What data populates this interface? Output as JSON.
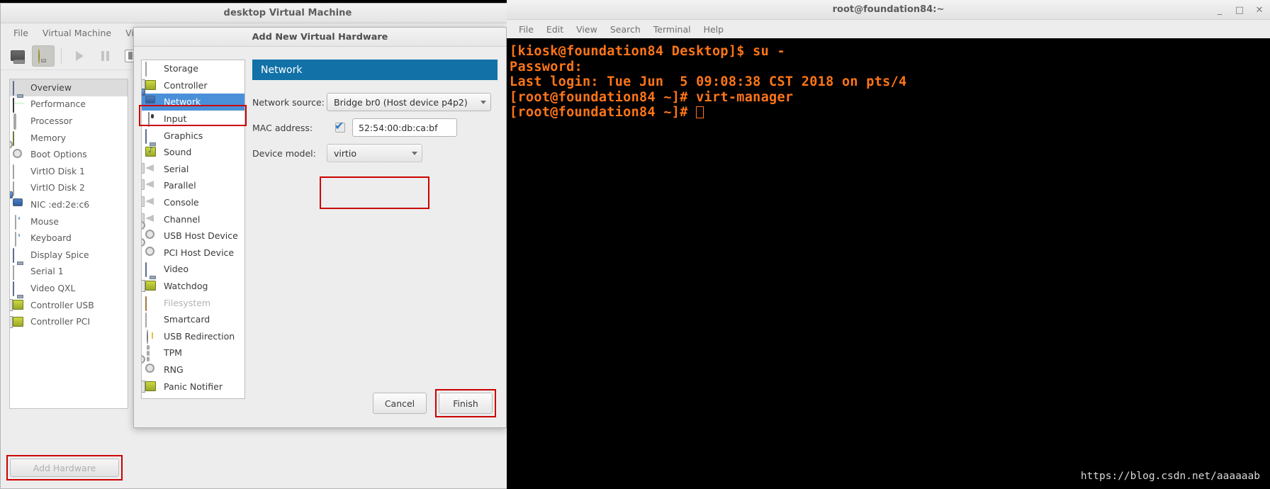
{
  "vm_window": {
    "title": "desktop Virtual Machine",
    "window_buttons": [
      {
        "name": "minimize",
        "glyph": "_"
      },
      {
        "name": "maximize",
        "glyph": "□"
      },
      {
        "name": "close",
        "glyph": "✕"
      }
    ],
    "menus": [
      "File",
      "Virtual Machine",
      "View"
    ],
    "toolbar": [
      {
        "name": "show-console-button",
        "icon": "monitor-icon"
      },
      {
        "name": "show-details-button",
        "icon": "lightbulb-icon"
      },
      {
        "name": "run-button",
        "icon": "play-icon"
      },
      {
        "name": "pause-button",
        "icon": "pause-icon"
      },
      {
        "name": "shutdown-button",
        "icon": "power-icon"
      },
      {
        "name": "shutdown-menu-button",
        "icon": "chevron-down-icon"
      }
    ],
    "hardware_items": [
      {
        "label": "Overview",
        "icon": "monitor-icon",
        "selected": true
      },
      {
        "label": "Performance",
        "icon": "performance-graph-icon",
        "selected": false
      },
      {
        "label": "Processor",
        "icon": "cpu-icon",
        "selected": false
      },
      {
        "label": "Memory",
        "icon": "memory-icon",
        "selected": false
      },
      {
        "label": "Boot Options",
        "icon": "gears-icon",
        "selected": false
      },
      {
        "label": "VirtIO Disk 1",
        "icon": "disk-icon",
        "selected": false
      },
      {
        "label": "VirtIO Disk 2",
        "icon": "disk-icon",
        "selected": false
      },
      {
        "label": "NIC :ed:2e:c6",
        "icon": "network-icon",
        "selected": false
      },
      {
        "label": "Mouse",
        "icon": "mouse-icon",
        "selected": false
      },
      {
        "label": "Keyboard",
        "icon": "mouse-icon",
        "selected": false
      },
      {
        "label": "Display Spice",
        "icon": "monitor-icon",
        "selected": false
      },
      {
        "label": "Serial 1",
        "icon": "serial-icon",
        "selected": false
      },
      {
        "label": "Video QXL",
        "icon": "monitor-icon",
        "selected": false
      },
      {
        "label": "Controller USB",
        "icon": "pci-card-icon",
        "selected": false
      },
      {
        "label": "Controller PCI",
        "icon": "pci-card-icon",
        "selected": false
      }
    ],
    "add_hardware_label": "Add Hardware"
  },
  "dialog": {
    "title": "Add New Virtual Hardware",
    "device_list": [
      {
        "label": "Storage",
        "icon": "disk-icon",
        "selected": false,
        "disabled": false
      },
      {
        "label": "Controller",
        "icon": "pci-card-icon",
        "selected": false,
        "disabled": false
      },
      {
        "label": "Network",
        "icon": "network-icon",
        "selected": true,
        "disabled": false
      },
      {
        "label": "Input",
        "icon": "input-device-icon",
        "selected": false,
        "disabled": false
      },
      {
        "label": "Graphics",
        "icon": "monitor-icon",
        "selected": false,
        "disabled": false
      },
      {
        "label": "Sound",
        "icon": "sound-card-icon",
        "selected": false,
        "disabled": false
      },
      {
        "label": "Serial",
        "icon": "serial-port-icon",
        "selected": false,
        "disabled": false
      },
      {
        "label": "Parallel",
        "icon": "serial-port-icon",
        "selected": false,
        "disabled": false
      },
      {
        "label": "Console",
        "icon": "serial-port-icon",
        "selected": false,
        "disabled": false
      },
      {
        "label": "Channel",
        "icon": "serial-port-icon",
        "selected": false,
        "disabled": false
      },
      {
        "label": "USB Host Device",
        "icon": "gears-icon",
        "selected": false,
        "disabled": false
      },
      {
        "label": "PCI Host Device",
        "icon": "gears-icon",
        "selected": false,
        "disabled": false
      },
      {
        "label": "Video",
        "icon": "monitor-icon",
        "selected": false,
        "disabled": false
      },
      {
        "label": "Watchdog",
        "icon": "pci-card-icon",
        "selected": false,
        "disabled": false
      },
      {
        "label": "Filesystem",
        "icon": "folder-icon",
        "selected": false,
        "disabled": true
      },
      {
        "label": "Smartcard",
        "icon": "smartcard-icon",
        "selected": false,
        "disabled": false
      },
      {
        "label": "USB Redirection",
        "icon": "usb-icon",
        "selected": false,
        "disabled": false
      },
      {
        "label": "TPM",
        "icon": "tpm-chip-icon",
        "selected": false,
        "disabled": false
      },
      {
        "label": "RNG",
        "icon": "gears-icon",
        "selected": false,
        "disabled": false
      },
      {
        "label": "Panic Notifier",
        "icon": "pci-card-icon",
        "selected": false,
        "disabled": false
      }
    ],
    "panel": {
      "header": "Network",
      "network_source_label": "Network source:",
      "network_source_value": "Bridge br0 (Host device p4p2)",
      "mac_address_label": "MAC address:",
      "mac_address_checked": true,
      "mac_address_value": "52:54:00:db:ca:bf",
      "device_model_label": "Device model:",
      "device_model_value": "virtio"
    },
    "cancel_label": "Cancel",
    "finish_label": "Finish",
    "highlight_color": "#cc0000"
  },
  "terminal": {
    "title": "root@foundation84:~",
    "menus": [
      "File",
      "Edit",
      "View",
      "Search",
      "Terminal",
      "Help"
    ],
    "window_buttons": [
      {
        "name": "minimize",
        "glyph": "_"
      },
      {
        "name": "maximize",
        "glyph": "□"
      },
      {
        "name": "close",
        "glyph": "✕"
      }
    ],
    "text_color": "#ff7518",
    "lines": [
      "[kiosk@foundation84 Desktop]$ su -",
      "Password:",
      "Last login: Tue Jun  5 09:08:38 CST 2018 on pts/4",
      "[root@foundation84 ~]# virt-manager",
      "[root@foundation84 ~]# "
    ]
  },
  "watermark": "https://blog.csdn.net/aaaaaab"
}
